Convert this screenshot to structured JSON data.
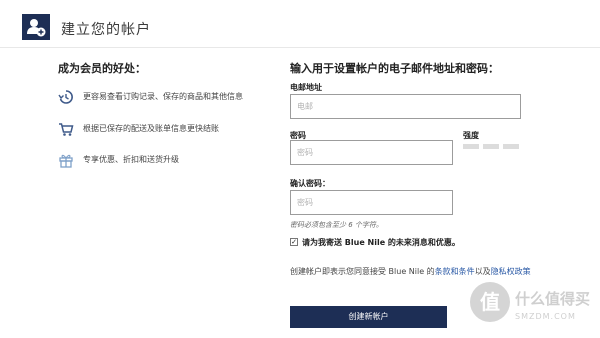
{
  "header": {
    "title": "建立您的帐户",
    "icon": "add-user-icon",
    "icon_bg": "#1d2e55"
  },
  "benefits": {
    "heading": "成为会员的好处：",
    "items": [
      {
        "icon": "history-icon",
        "text": "更容易查看订购记录、保存的商品和其他信息"
      },
      {
        "icon": "cart-icon",
        "text": "根据已保存的配送及账单信息更快结账"
      },
      {
        "icon": "gift-icon",
        "text": "专享优惠、折扣和送货升级"
      }
    ]
  },
  "form": {
    "heading": "输入用于设置帐户的电子邮件地址和密码：",
    "email_label": "电邮地址",
    "email_placeholder": "电邮",
    "password_label": "密码",
    "password_placeholder": "密码",
    "strength_label": "强度",
    "confirm_label": "确认密码：",
    "confirm_placeholder": "密码",
    "hint": "密码必须包含至少 6 个字符。",
    "checkbox_checked": true,
    "checkbox_label": "请为我寄送 Blue Nile 的未来消息和优惠。",
    "terms_prefix": "创建帐户即表示您同意接受 Blue Nile 的",
    "terms_link": "条款和条件",
    "terms_mid": "以及",
    "privacy_link": "隐私权政策",
    "submit_label": "创建新帐户",
    "accent": "#1d2e55",
    "link_color": "#2b5aa6"
  },
  "watermark": {
    "text": "什么值得买",
    "sub": "SMZDM.COM"
  }
}
